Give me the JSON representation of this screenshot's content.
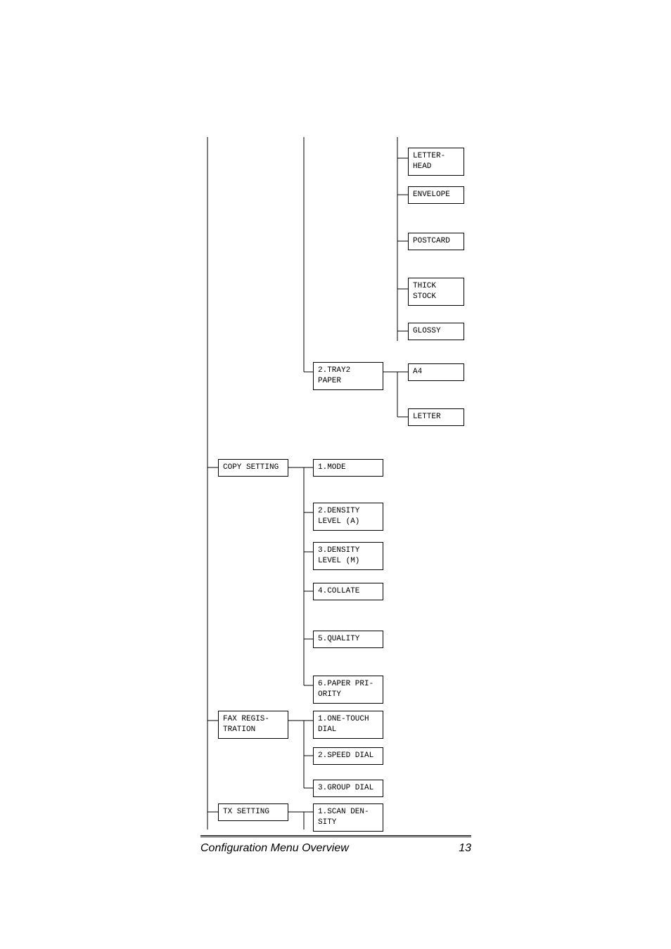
{
  "footer": {
    "title": "Configuration Menu Overview",
    "page": "13"
  },
  "col3": {
    "letterhead": "LETTER-\nHEAD",
    "envelope": "ENVELOPE",
    "postcard": "POSTCARD",
    "thickstock": "THICK\nSTOCK",
    "glossy": "GLOSSY",
    "a4": "A4",
    "letter": "LETTER"
  },
  "col2": {
    "tray2": "2.TRAY2\nPAPER",
    "mode": "1.MODE",
    "densityA": "2.DENSITY\nLEVEL (A)",
    "densityM": "3.DENSITY\nLEVEL (M)",
    "collate": "4.COLLATE",
    "quality": "5.QUALITY",
    "paperpri": "6.PAPER PRI-\nORITY",
    "onetouch": "1.ONE-TOUCH\nDIAL",
    "speed": "2.SPEED DIAL",
    "group": "3.GROUP DIAL",
    "scanden": "1.SCAN DEN-\nSITY"
  },
  "col1": {
    "copy": "COPY SETTING",
    "faxreg": "FAX REGIS-\nTRATION",
    "txset": "TX SETTING"
  }
}
